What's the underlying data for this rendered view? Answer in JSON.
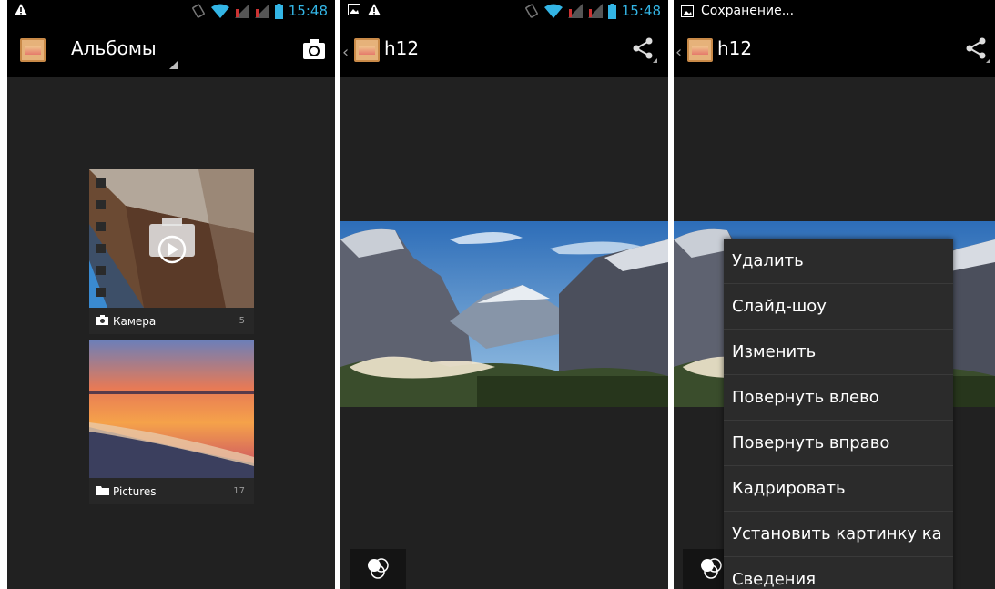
{
  "status": {
    "time": "15:48",
    "saving_text": "Сохранение..."
  },
  "albums_screen": {
    "title": "Альбомы",
    "albums": [
      {
        "name": "Камера",
        "count": "5",
        "icon": "camera-icon"
      },
      {
        "name": "Pictures",
        "count": "17",
        "icon": "folder-icon"
      }
    ]
  },
  "photo_screen": {
    "title": "h12"
  },
  "menu_screen": {
    "title": "h12",
    "menu_items": [
      "Удалить",
      "Слайд-шоу",
      "Изменить",
      "Повернуть влево",
      "Повернуть вправо",
      "Кадрировать",
      "Установить картинку ка",
      "Сведения"
    ]
  },
  "colors": {
    "accent": "#33b5e5",
    "background": "#212121",
    "bar": "#000000"
  }
}
